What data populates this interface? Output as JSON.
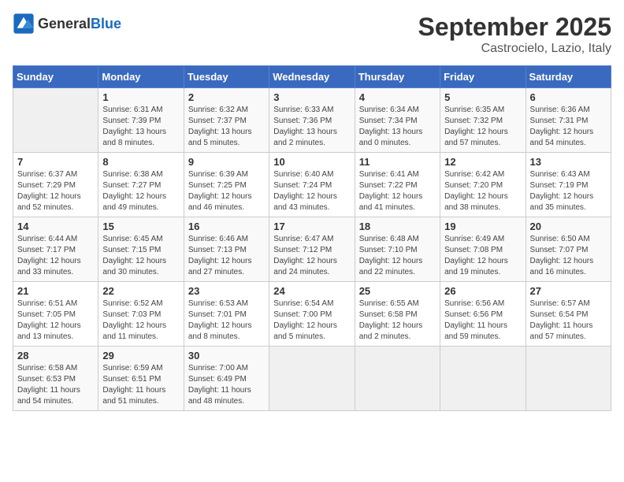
{
  "header": {
    "logo_general": "General",
    "logo_blue": "Blue",
    "month": "September 2025",
    "location": "Castrocielo, Lazio, Italy"
  },
  "days_of_week": [
    "Sunday",
    "Monday",
    "Tuesday",
    "Wednesday",
    "Thursday",
    "Friday",
    "Saturday"
  ],
  "weeks": [
    [
      {
        "day": "",
        "info": ""
      },
      {
        "day": "1",
        "info": "Sunrise: 6:31 AM\nSunset: 7:39 PM\nDaylight: 13 hours\nand 8 minutes."
      },
      {
        "day": "2",
        "info": "Sunrise: 6:32 AM\nSunset: 7:37 PM\nDaylight: 13 hours\nand 5 minutes."
      },
      {
        "day": "3",
        "info": "Sunrise: 6:33 AM\nSunset: 7:36 PM\nDaylight: 13 hours\nand 2 minutes."
      },
      {
        "day": "4",
        "info": "Sunrise: 6:34 AM\nSunset: 7:34 PM\nDaylight: 13 hours\nand 0 minutes."
      },
      {
        "day": "5",
        "info": "Sunrise: 6:35 AM\nSunset: 7:32 PM\nDaylight: 12 hours\nand 57 minutes."
      },
      {
        "day": "6",
        "info": "Sunrise: 6:36 AM\nSunset: 7:31 PM\nDaylight: 12 hours\nand 54 minutes."
      }
    ],
    [
      {
        "day": "7",
        "info": "Sunrise: 6:37 AM\nSunset: 7:29 PM\nDaylight: 12 hours\nand 52 minutes."
      },
      {
        "day": "8",
        "info": "Sunrise: 6:38 AM\nSunset: 7:27 PM\nDaylight: 12 hours\nand 49 minutes."
      },
      {
        "day": "9",
        "info": "Sunrise: 6:39 AM\nSunset: 7:25 PM\nDaylight: 12 hours\nand 46 minutes."
      },
      {
        "day": "10",
        "info": "Sunrise: 6:40 AM\nSunset: 7:24 PM\nDaylight: 12 hours\nand 43 minutes."
      },
      {
        "day": "11",
        "info": "Sunrise: 6:41 AM\nSunset: 7:22 PM\nDaylight: 12 hours\nand 41 minutes."
      },
      {
        "day": "12",
        "info": "Sunrise: 6:42 AM\nSunset: 7:20 PM\nDaylight: 12 hours\nand 38 minutes."
      },
      {
        "day": "13",
        "info": "Sunrise: 6:43 AM\nSunset: 7:19 PM\nDaylight: 12 hours\nand 35 minutes."
      }
    ],
    [
      {
        "day": "14",
        "info": "Sunrise: 6:44 AM\nSunset: 7:17 PM\nDaylight: 12 hours\nand 33 minutes."
      },
      {
        "day": "15",
        "info": "Sunrise: 6:45 AM\nSunset: 7:15 PM\nDaylight: 12 hours\nand 30 minutes."
      },
      {
        "day": "16",
        "info": "Sunrise: 6:46 AM\nSunset: 7:13 PM\nDaylight: 12 hours\nand 27 minutes."
      },
      {
        "day": "17",
        "info": "Sunrise: 6:47 AM\nSunset: 7:12 PM\nDaylight: 12 hours\nand 24 minutes."
      },
      {
        "day": "18",
        "info": "Sunrise: 6:48 AM\nSunset: 7:10 PM\nDaylight: 12 hours\nand 22 minutes."
      },
      {
        "day": "19",
        "info": "Sunrise: 6:49 AM\nSunset: 7:08 PM\nDaylight: 12 hours\nand 19 minutes."
      },
      {
        "day": "20",
        "info": "Sunrise: 6:50 AM\nSunset: 7:07 PM\nDaylight: 12 hours\nand 16 minutes."
      }
    ],
    [
      {
        "day": "21",
        "info": "Sunrise: 6:51 AM\nSunset: 7:05 PM\nDaylight: 12 hours\nand 13 minutes."
      },
      {
        "day": "22",
        "info": "Sunrise: 6:52 AM\nSunset: 7:03 PM\nDaylight: 12 hours\nand 11 minutes."
      },
      {
        "day": "23",
        "info": "Sunrise: 6:53 AM\nSunset: 7:01 PM\nDaylight: 12 hours\nand 8 minutes."
      },
      {
        "day": "24",
        "info": "Sunrise: 6:54 AM\nSunset: 7:00 PM\nDaylight: 12 hours\nand 5 minutes."
      },
      {
        "day": "25",
        "info": "Sunrise: 6:55 AM\nSunset: 6:58 PM\nDaylight: 12 hours\nand 2 minutes."
      },
      {
        "day": "26",
        "info": "Sunrise: 6:56 AM\nSunset: 6:56 PM\nDaylight: 11 hours\nand 59 minutes."
      },
      {
        "day": "27",
        "info": "Sunrise: 6:57 AM\nSunset: 6:54 PM\nDaylight: 11 hours\nand 57 minutes."
      }
    ],
    [
      {
        "day": "28",
        "info": "Sunrise: 6:58 AM\nSunset: 6:53 PM\nDaylight: 11 hours\nand 54 minutes."
      },
      {
        "day": "29",
        "info": "Sunrise: 6:59 AM\nSunset: 6:51 PM\nDaylight: 11 hours\nand 51 minutes."
      },
      {
        "day": "30",
        "info": "Sunrise: 7:00 AM\nSunset: 6:49 PM\nDaylight: 11 hours\nand 48 minutes."
      },
      {
        "day": "",
        "info": ""
      },
      {
        "day": "",
        "info": ""
      },
      {
        "day": "",
        "info": ""
      },
      {
        "day": "",
        "info": ""
      }
    ]
  ]
}
